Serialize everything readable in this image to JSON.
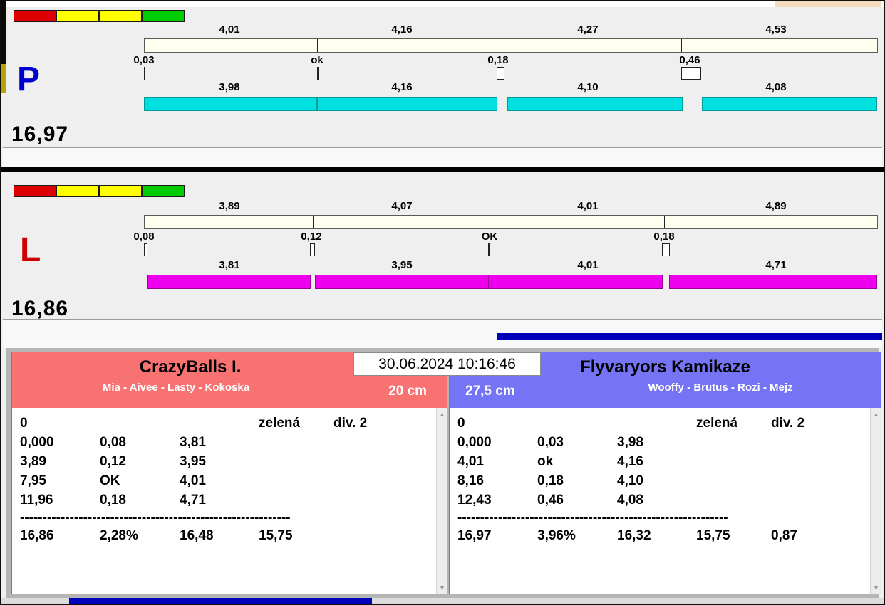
{
  "colors": {
    "light_red": "#dd0000",
    "light_yellow": "#ffff00",
    "light_green": "#00cc00",
    "p_letter": "#0000cc",
    "l_letter": "#cc0000",
    "p_bar": "#00e0e0",
    "l_bar": "#ee00ee",
    "ideal_bar_bg": "#fffff0",
    "header_left": "#f87272",
    "header_right": "#7474f4",
    "progress": "#0000bb"
  },
  "icons": {
    "scroll_up": "▲",
    "scroll_down": "▼"
  },
  "lanes": {
    "p": {
      "letter": "P",
      "total": "16,97",
      "ideal_segments": [
        "4,01",
        "4,16",
        "4,27",
        "4,53"
      ],
      "markers": [
        "0,03",
        "ok",
        "0,18",
        "0,46"
      ],
      "actual_segments": [
        "3,98",
        "4,16",
        "4,10",
        "4,08"
      ]
    },
    "l": {
      "letter": "L",
      "total": "16,86",
      "ideal_segments": [
        "3,89",
        "4,07",
        "4,01",
        "4,89"
      ],
      "markers": [
        "0,08",
        "0,12",
        "OK",
        "0,18"
      ],
      "actual_segments": [
        "3,81",
        "3,95",
        "4,01",
        "4,71"
      ]
    }
  },
  "scoreboard": {
    "datetime": "30.06.2024 10:16:46",
    "left": {
      "team": "CrazyBalls I.",
      "dogs": "Mia - Aivee - Lasty - Kokoska",
      "height": "20 cm",
      "rows": [
        [
          "0",
          "",
          "",
          "zelená",
          "div. 2"
        ],
        [
          "0,000",
          "0,08",
          "3,81",
          "",
          ""
        ],
        [
          "3,89",
          "0,12",
          "3,95",
          "",
          ""
        ],
        [
          "7,95",
          "OK",
          "4,01",
          "",
          ""
        ],
        [
          "11,96",
          "0,18",
          "4,71",
          "",
          ""
        ]
      ],
      "separator": "------------------------------------------------------------",
      "summary": [
        "16,86",
        "2,28%",
        "16,48",
        "15,75",
        ""
      ]
    },
    "right": {
      "team": "Flyvaryors Kamikaze",
      "dogs": "Wooffy - Brutus - Rozi - Mejz",
      "height": "27,5 cm",
      "rows": [
        [
          "0",
          "",
          "",
          "zelená",
          "div. 2"
        ],
        [
          "0,000",
          "0,03",
          "3,98",
          "",
          ""
        ],
        [
          "4,01",
          "ok",
          "4,16",
          "",
          ""
        ],
        [
          "8,16",
          "0,18",
          "4,10",
          "",
          ""
        ],
        [
          "12,43",
          "0,46",
          "4,08",
          "",
          ""
        ]
      ],
      "separator": "------------------------------------------------------------",
      "summary": [
        "16,97",
        "3,96%",
        "16,32",
        "15,75",
        "0,87"
      ]
    }
  }
}
